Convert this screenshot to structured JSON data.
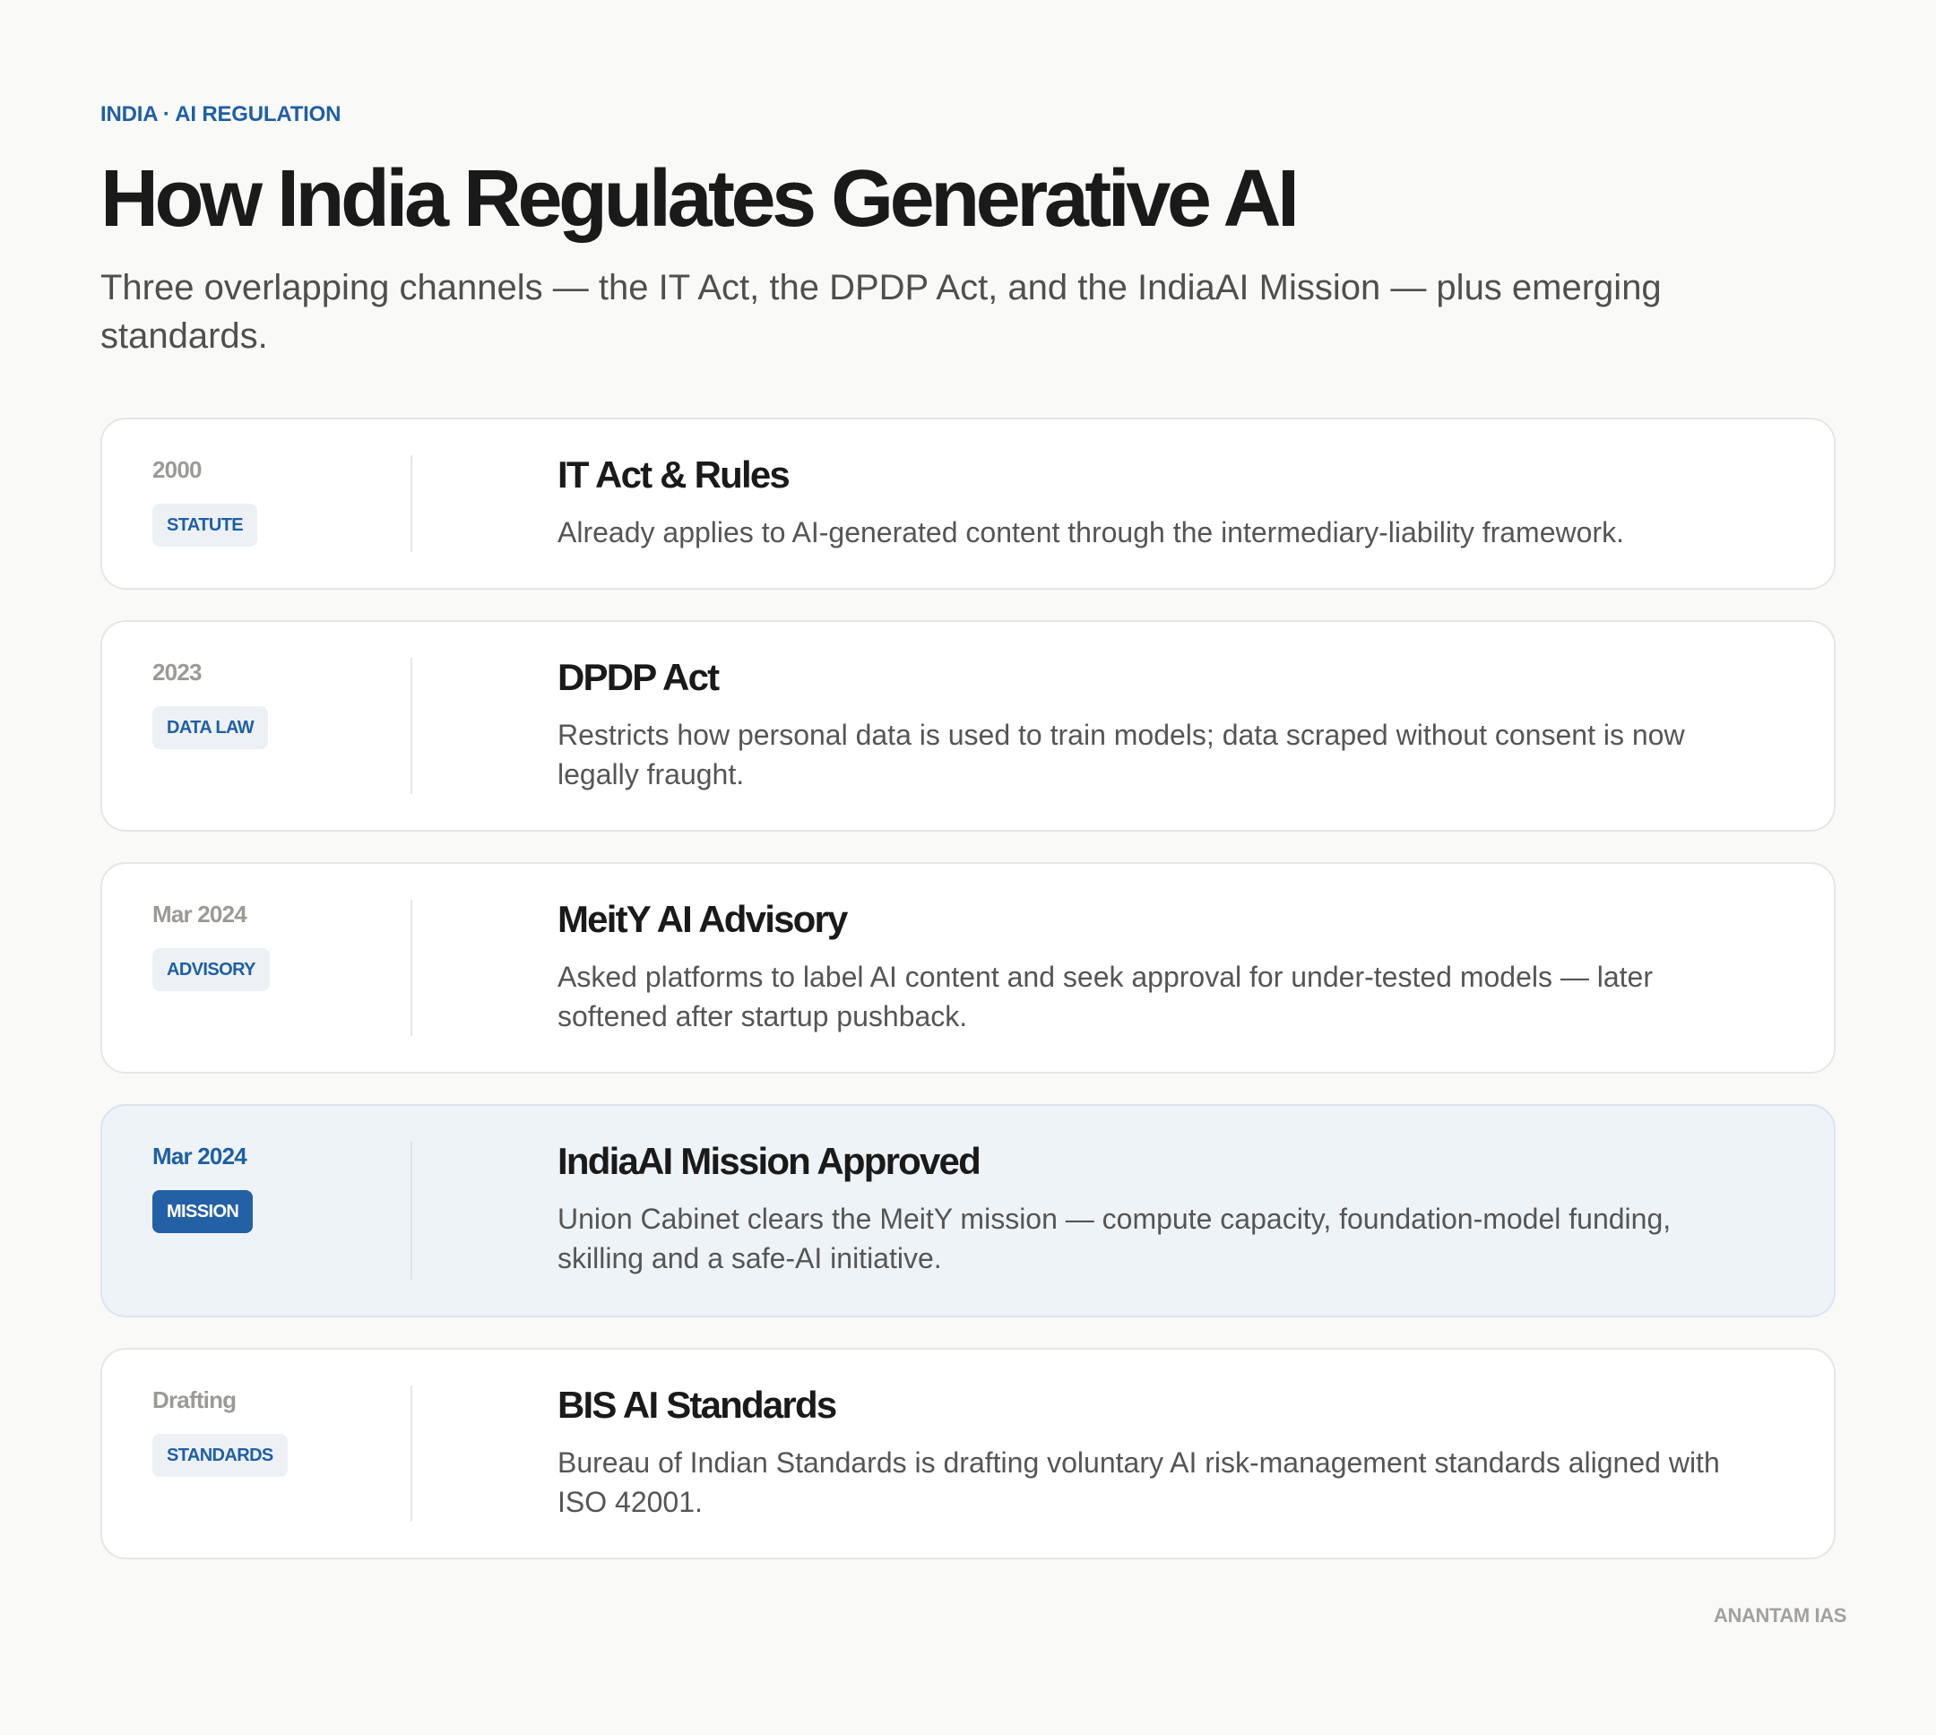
{
  "header": {
    "eyebrow": "INDIA · AI REGULATION",
    "title": "How India Regulates Generative AI",
    "subtitle": "Three overlapping channels — the IT Act, the DPDP Act, and the IndiaAI Mission — plus emerging standards."
  },
  "items": [
    {
      "date": "2000",
      "badge": "STATUTE",
      "title": "IT Act & Rules",
      "description": "Already applies to AI-generated content through the intermediary-liability framework."
    },
    {
      "date": "2023",
      "badge": "DATA LAW",
      "title": "DPDP Act",
      "description": "Restricts how personal data is used to train models; data scraped without consent is now legally fraught."
    },
    {
      "date": "Mar 2024",
      "badge": "ADVISORY",
      "title": "MeitY AI Advisory",
      "description": "Asked platforms to label AI content and seek approval for under-tested models — later softened after startup pushback."
    },
    {
      "date": "Mar 2024",
      "badge": "MISSION",
      "title": "IndiaAI Mission Approved",
      "description": "Union Cabinet clears the MeitY mission — compute capacity, foundation-model funding, skilling and a safe-AI initiative."
    },
    {
      "date": "Drafting",
      "badge": "STANDARDS",
      "title": "BIS AI Standards",
      "description": "Bureau of Indian Standards is drafting voluntary AI risk-management standards aligned with ISO 42001."
    }
  ],
  "footer": {
    "brand": "ANANTAM IAS"
  },
  "colors": {
    "accent": "#1f5fa3",
    "highlight_background": "#eef3f8",
    "page_background": "#f9f9f8"
  }
}
